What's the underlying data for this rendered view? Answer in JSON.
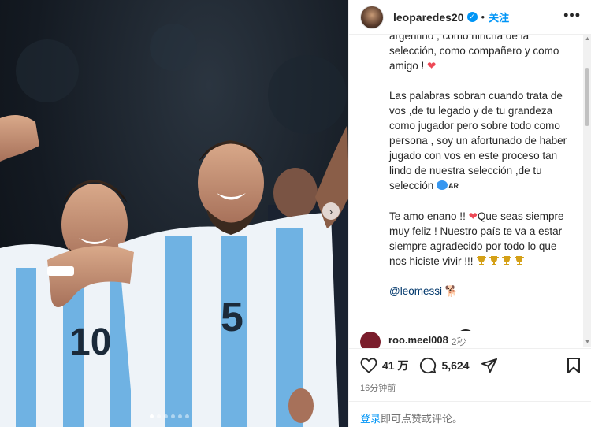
{
  "post": {
    "username": "leoparedes20",
    "follow_label": "关注",
    "separator": "•",
    "more_label": "•••",
    "caption": {
      "line_partial": "argentino , como hincha de la selección, como compañero y como amigo !",
      "para2": "Las palabras sobran cuando  trata de vos ,de tu legado y de tu grandeza como jugador pero sobre todo como persona , soy un afortunado de haber jugado con vos en  este proceso tan lindo de nuestra selección ,de tu selección",
      "flag_text": "AR",
      "para3_a": "Te amo enano !!",
      "para3_b": "Que seas siempre muy feliz ! Nuestro país te va a estar siempre agradecido por todo lo que nos hiciste vivir !!!",
      "mention": "@leomessi"
    },
    "load_more_label": "+",
    "comment": {
      "username": "roo.meel008",
      "time": "2秒"
    },
    "likes": "41 万",
    "comments_count": "5,624",
    "time_ago": "16分钟前",
    "login_link": "登录",
    "login_text": "即可点赞或评论。"
  },
  "carousel": {
    "next_label": "›",
    "dots": 6,
    "active_index": 0
  },
  "colors": {
    "accent": "#0095f6",
    "heart": "#ed4956",
    "mention": "#00376b"
  },
  "icons": [
    "verified-icon",
    "more-icon",
    "next-arrow-icon",
    "heart-icon",
    "comment-icon",
    "share-icon",
    "bookmark-icon",
    "add-circle-icon",
    "trophy-icon",
    "dog-icon"
  ]
}
